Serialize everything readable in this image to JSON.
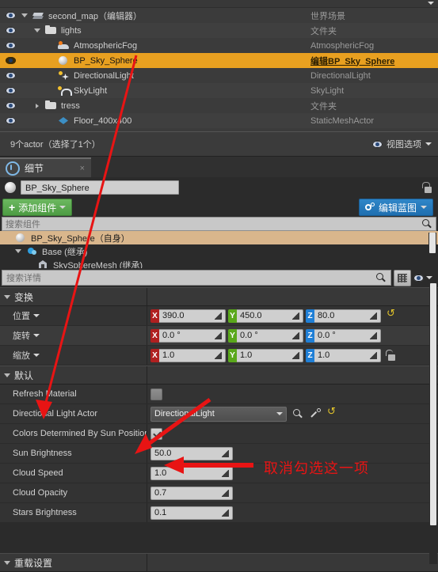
{
  "outliner": {
    "rows": [
      {
        "name": "second_map（编辑器）",
        "type": "世界场景",
        "icon": "level-icon",
        "indent": 0,
        "arrow": "open",
        "selected": false
      },
      {
        "name": "lights",
        "type": "文件夹",
        "icon": "folder-icon",
        "indent": 1,
        "arrow": "open",
        "selected": false
      },
      {
        "name": "AtmosphericFog",
        "type": "AtmosphericFog",
        "icon": "fog-icon",
        "indent": 2,
        "arrow": "none",
        "selected": false
      },
      {
        "name": "BP_Sky_Sphere",
        "type": "编辑BP_Sky_Sphere",
        "icon": "sphere-icon",
        "indent": 2,
        "arrow": "none",
        "selected": true
      },
      {
        "name": "DirectionalLight",
        "type": "DirectionalLight",
        "icon": "directional-light-icon",
        "indent": 2,
        "arrow": "none",
        "selected": false
      },
      {
        "name": "SkyLight",
        "type": "SkyLight",
        "icon": "sky-light-icon",
        "indent": 2,
        "arrow": "none",
        "selected": false
      },
      {
        "name": "tress",
        "type": "文件夹",
        "icon": "folder-icon",
        "indent": 1,
        "arrow": "closed",
        "selected": false
      },
      {
        "name": "Floor_400x400",
        "type": "StaticMeshActor",
        "icon": "static-mesh-icon",
        "indent": 2,
        "arrow": "none",
        "selected": false
      }
    ]
  },
  "statusbar": {
    "count_label": "9个actor（选择了1个）",
    "view_options_label": "视图选项"
  },
  "details": {
    "tab_label": "细节",
    "tab_close": "×",
    "actor_name": "BP_Sky_Sphere",
    "add_component_label": "添加组件",
    "add_component_plus": "+",
    "edit_blueprint_label": "编辑蓝图",
    "search_component_placeholder": "搜索组件",
    "component_tree": [
      {
        "label": "BP_Sky_Sphere（自身）",
        "icon": "sphere-icon",
        "indent": 0,
        "selected": true,
        "arrow": "none"
      },
      {
        "label": "Base (继承)",
        "icon": "component-icon",
        "indent": 1,
        "selected": false,
        "arrow": "open"
      },
      {
        "label": "SkySphereMesh (继承)",
        "icon": "mesh-icon",
        "indent": 2,
        "selected": false,
        "arrow": "none"
      }
    ],
    "search_details_placeholder": "搜索详情"
  },
  "transform": {
    "section_label": "变换",
    "rows": [
      {
        "label": "位置",
        "x": "390.0",
        "y": "450.0",
        "z": "80.0",
        "trailing": "reset-icon"
      },
      {
        "label": "旋转",
        "x": "0.0 °",
        "y": "0.0 °",
        "z": "0.0 °",
        "trailing": "none"
      },
      {
        "label": "缩放",
        "x": "1.0",
        "y": "1.0",
        "z": "1.0",
        "trailing": "lock-icon"
      }
    ]
  },
  "defaults": {
    "section_label": "默认",
    "rows": [
      {
        "label": "Refresh Material",
        "kind": "checkbox",
        "checked": false
      },
      {
        "label": "Directional Light Actor",
        "kind": "object",
        "value": "DirectionalLight"
      },
      {
        "label": "Colors Determined By Sun Position",
        "kind": "checkbox",
        "checked": true
      },
      {
        "label": "Sun Brightness",
        "kind": "number",
        "value": "50.0"
      },
      {
        "label": "Cloud Speed",
        "kind": "number",
        "value": "1.0"
      },
      {
        "label": "Cloud Opacity",
        "kind": "number",
        "value": "0.7"
      },
      {
        "label": "Stars Brightness",
        "kind": "number",
        "value": "0.1"
      }
    ]
  },
  "override": {
    "section_label": "重载设置"
  },
  "annotation": {
    "text": "取消勾选这一项",
    "color": "#e81414"
  },
  "colors": {
    "selection_orange": "#e8a020",
    "component_selection_tan": "#d9b68c",
    "add_button_green": "#4d9c43",
    "blueprint_button_blue": "#1f6fb0",
    "axis_x_red": "#b02020",
    "axis_y_green": "#5aa81b",
    "axis_z_blue": "#1f7fd6",
    "panel_bg": "#2b2b2b",
    "outliner_bg": "#3b3b3b"
  }
}
